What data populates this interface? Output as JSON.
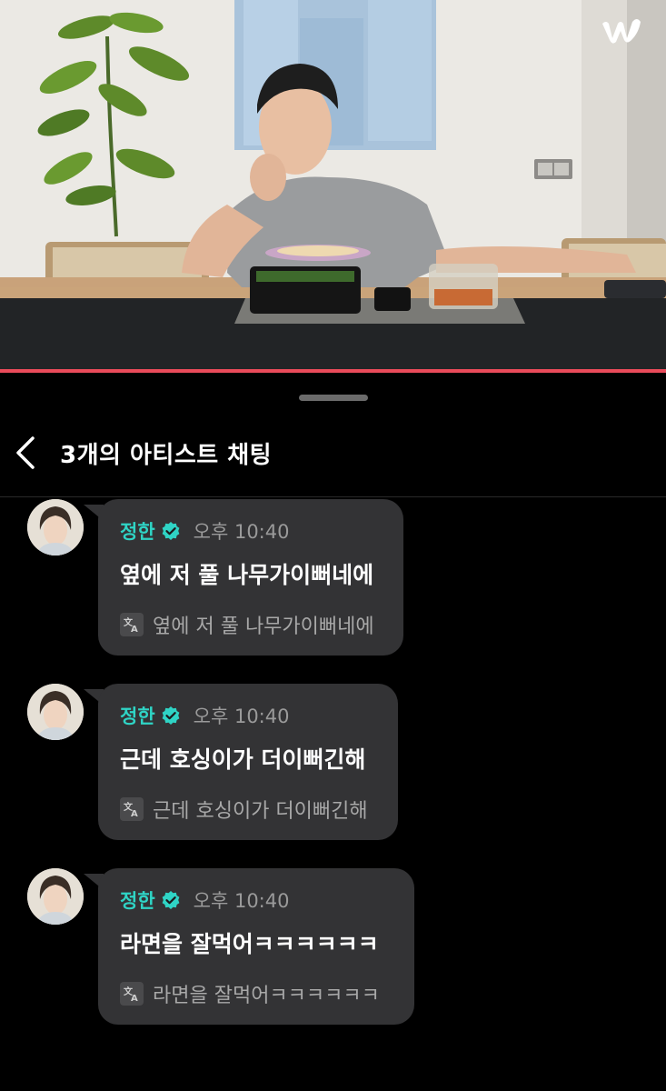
{
  "video": {
    "brand_logo": "weverse-logo",
    "progress_fraction": 1.0,
    "progress_color": "#ea4b5a"
  },
  "chat": {
    "title": "3개의 아티스트 채팅",
    "back_icon": "chevron-left-icon"
  },
  "messages": [
    {
      "sender": "정한",
      "time": "오후 10:40",
      "text": "옆에 저 풀 나무가이뻐네에",
      "translation": "옆에 저 풀 나무가이뻐네에"
    },
    {
      "sender": "정한",
      "time": "오후 10:40",
      "text": "근데 호싱이가 더이뻐긴해",
      "translation": "근데 호싱이가 더이뻐긴해"
    },
    {
      "sender": "정한",
      "time": "오후 10:40",
      "text": "라면을 잘먹어ㅋㅋㅋㅋㅋㅋ",
      "translation": "라면을 잘먹어ㅋㅋㅋㅋㅋㅋ"
    }
  ],
  "colors": {
    "background": "#000000",
    "bubble": "#333335",
    "sender_name": "#2fd4c5",
    "verified_badge": "#2fd4c5",
    "timestamp": "#9a9a9a",
    "translated_text": "#a8a8a8"
  }
}
